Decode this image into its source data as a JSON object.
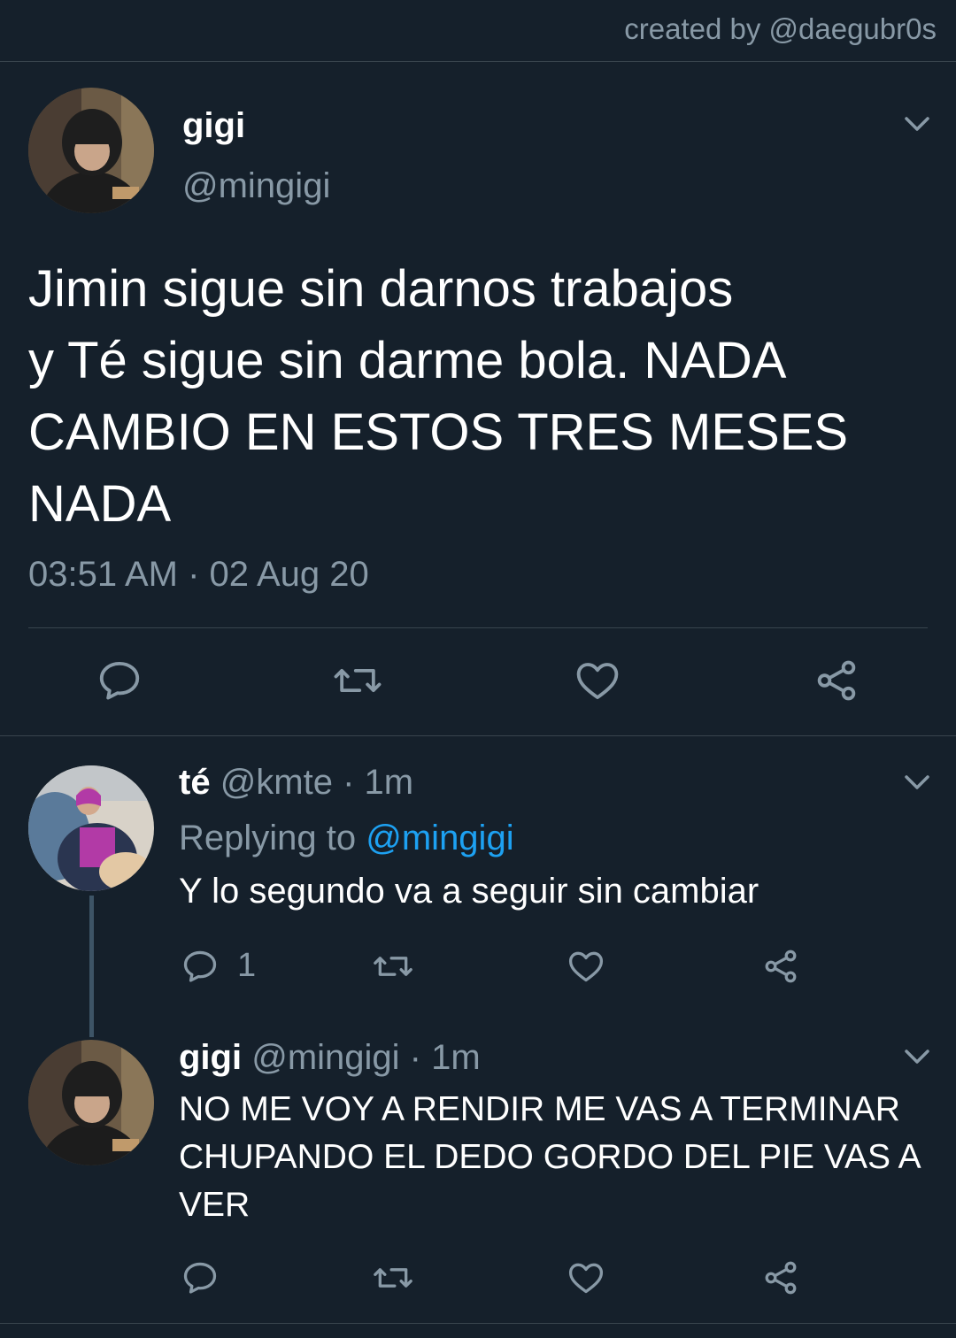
{
  "credit": "created by @daegubr0s",
  "main_tweet": {
    "name": "gigi",
    "handle": "@mingigi",
    "text_lines": [
      "Jimin sigue sin darnos trabajos",
      "y Té sigue sin darme bola. NADA",
      "CAMBIO EN ESTOS TRES MESES",
      "NADA"
    ],
    "timestamp": "03:51 AM · 02 Aug 20"
  },
  "reply1": {
    "name": "té",
    "handle_time": "@kmte · 1m",
    "replying_prefix": "Replying to",
    "replying_handle": "@mingigi",
    "text": "Y lo segundo va a seguir sin cambiar",
    "reply_count": "1"
  },
  "reply2": {
    "name": "gigi",
    "handle_time": "@mingigi · 1m",
    "text_lines": [
      "NO ME VOY A RENDIR ME VAS A TERMINAR",
      "CHUPANDO EL DEDO GORDO DEL PIE VAS A",
      "VER"
    ]
  },
  "colors": {
    "background": "#15202b",
    "muted": "#8899a6",
    "link": "#1da1f2",
    "divider": "#38444d"
  },
  "icons": [
    "reply-icon",
    "retweet-icon",
    "like-icon",
    "share-icon",
    "chevron-down-icon"
  ]
}
